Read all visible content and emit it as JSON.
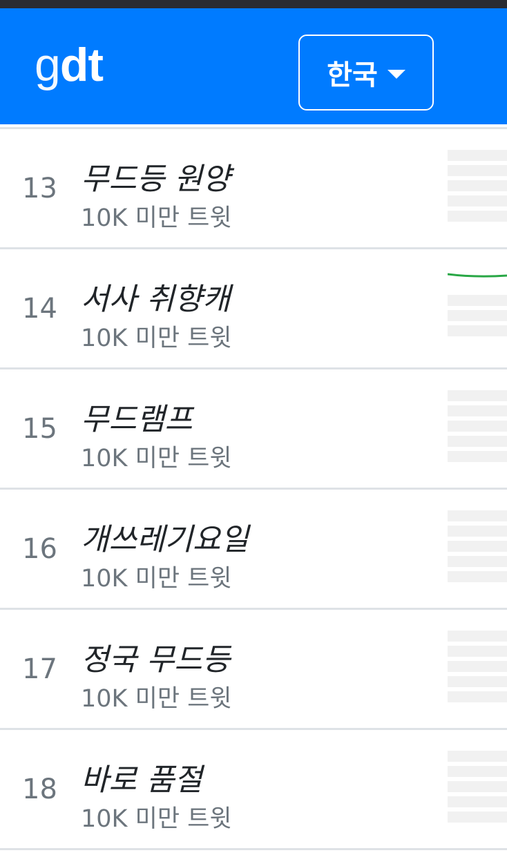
{
  "header": {
    "logo_thin": "g",
    "logo_bold": "dt",
    "country_label": "한국",
    "brand_color": "#007bff"
  },
  "trends": [
    {
      "rank": "13",
      "title": "무드등 원양",
      "count": "10K 미만 트윗",
      "trend": "flat"
    },
    {
      "rank": "14",
      "title": "서사 취향캐",
      "count": "10K 미만 트윗",
      "trend": "line"
    },
    {
      "rank": "15",
      "title": "무드램프",
      "count": "10K 미만 트윗",
      "trend": "flat"
    },
    {
      "rank": "16",
      "title": "개쓰레기요일",
      "count": "10K 미만 트윗",
      "trend": "flat"
    },
    {
      "rank": "17",
      "title": "정국 무드등",
      "count": "10K 미만 트윗",
      "trend": "flat"
    },
    {
      "rank": "18",
      "title": "바로 품절",
      "count": "10K 미만 트윗",
      "trend": "flat"
    }
  ],
  "colors": {
    "trend_line": "#28a745",
    "placeholder": "#f1f1f1"
  }
}
